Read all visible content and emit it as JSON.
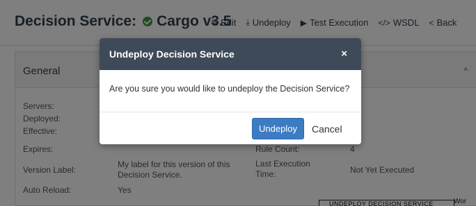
{
  "header": {
    "title": "Decision Service:",
    "service_name": "Cargo v3.5",
    "toolbar": [
      {
        "icon": "✎",
        "icon_name": "edit-icon",
        "label": "Edit"
      },
      {
        "icon": "⤓",
        "icon_name": "undeploy-icon",
        "label": "Undeploy"
      },
      {
        "icon": "▶",
        "icon_name": "play-icon",
        "label": "Test Execution"
      },
      {
        "icon": "</>",
        "icon_name": "code-icon",
        "label": "WSDL"
      },
      {
        "icon": "<",
        "icon_name": "chevron-left-icon",
        "label": "Back"
      }
    ]
  },
  "panel": {
    "title": "General",
    "collapse_icon": "^",
    "fields": {
      "servers": "Servers:",
      "deployed": "Deployed:",
      "effective": "Effective:",
      "expires": "Expires:",
      "version_label": "Version Label:",
      "version_label_value": "My label for this version of this Decision Service.",
      "auto_reload": "Auto Reload:",
      "auto_reload_value": "Yes",
      "rule_count": "Rule Count:",
      "rule_count_value": "4",
      "last_execution_time": "Last Execution Time:",
      "last_execution_time_value": "Not Yet Executed"
    }
  },
  "tooltip": {
    "text": "UNDEPLOY DECISION SERVICE",
    "tail": "Wor"
  },
  "modal": {
    "title": "Undeploy Decision Service",
    "close": "×",
    "message": "Are you sure you would like to undeploy the Decision Service?",
    "confirm_label": "Undeploy",
    "cancel_label": "Cancel"
  },
  "colors": {
    "modal_header": "#3f4a58",
    "primary_button": "#3d7cc2",
    "status_ok": "#3c9a3c",
    "backdrop": "rgba(0,0,0,0.5)"
  }
}
